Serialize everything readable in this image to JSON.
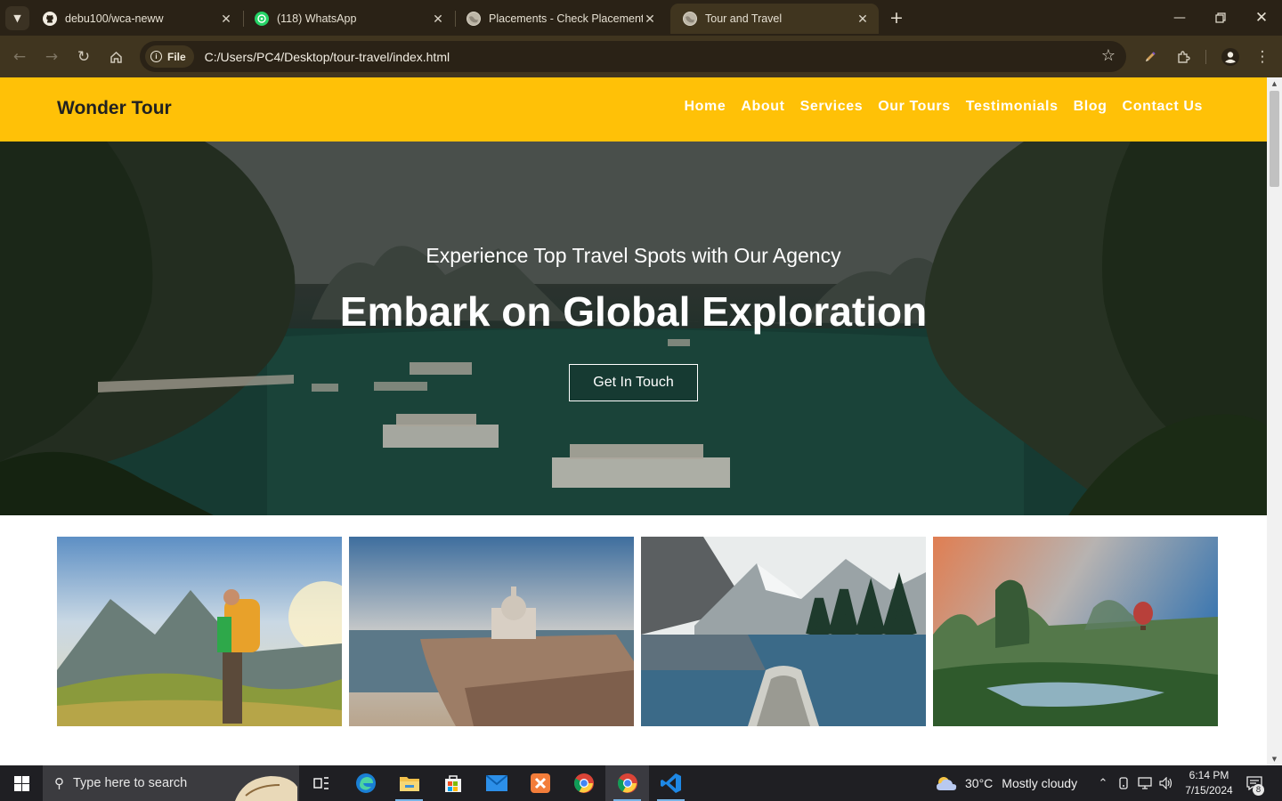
{
  "browser": {
    "tabs": [
      {
        "title": "debu100/wca-neww",
        "icon": "github-icon"
      },
      {
        "title": "(118) WhatsApp",
        "icon": "whatsapp-icon"
      },
      {
        "title": "Placements - Check Placement",
        "icon": "globe-icon"
      },
      {
        "title": "Tour and Travel",
        "icon": "globe-icon",
        "active": true
      }
    ],
    "address_chip": "File",
    "url": "C:/Users/PC4/Desktop/tour-travel/index.html"
  },
  "site": {
    "brand": "Wonder Tour",
    "colors": {
      "header": "#ffc107",
      "nav_text": "#ffffff"
    },
    "nav": [
      "Home",
      "About",
      "Services",
      "Our Tours",
      "Testimonials",
      "Blog",
      "Contact Us"
    ],
    "hero": {
      "subtitle": "Experience Top Travel Spots with Our Agency",
      "title_plain": "Embark on",
      "title_bold": "Global Exploration",
      "cta": "Get In Touch"
    },
    "gallery": [
      "hiker-mountains",
      "venice-coast",
      "mountain-lake-canoe",
      "karst-balloon-valley"
    ]
  },
  "taskbar": {
    "search_placeholder": "Type here to search",
    "weather": {
      "temp": "30°C",
      "condition": "Mostly cloudy"
    },
    "time": "6:14 PM",
    "date": "7/15/2024",
    "notification_count": "8"
  }
}
